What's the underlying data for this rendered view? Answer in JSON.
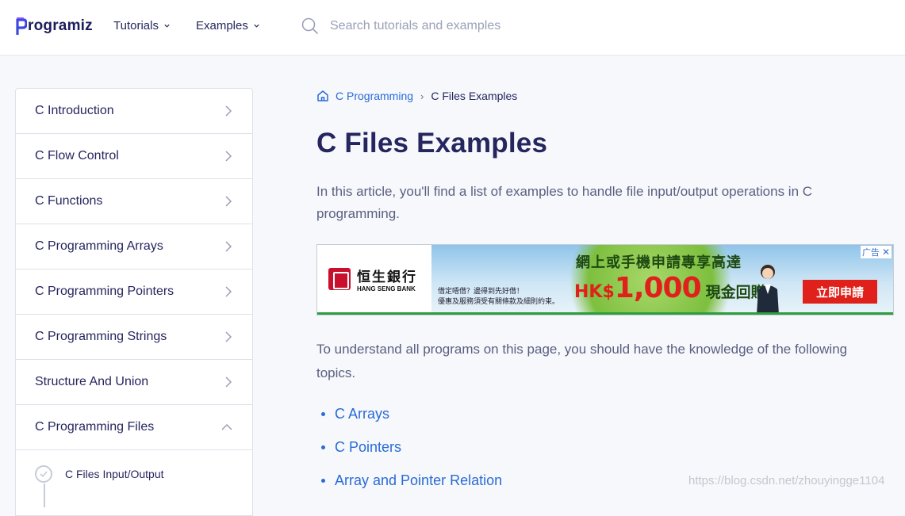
{
  "header": {
    "logo_text": "rogramiz",
    "nav": [
      {
        "label": "Tutorials"
      },
      {
        "label": "Examples"
      }
    ],
    "search_placeholder": "Search tutorials and examples"
  },
  "sidebar": {
    "items": [
      {
        "label": "C Introduction"
      },
      {
        "label": "C Flow Control"
      },
      {
        "label": "C Functions"
      },
      {
        "label": "C Programming Arrays"
      },
      {
        "label": "C Programming Pointers"
      },
      {
        "label": "C Programming Strings"
      },
      {
        "label": "Structure And Union"
      },
      {
        "label": "C Programming Files"
      }
    ],
    "sub_items": [
      {
        "label": "C Files Input/Output"
      }
    ]
  },
  "breadcrumb": {
    "parent": "C Programming",
    "current": "C Files Examples"
  },
  "main": {
    "title": "C Files Examples",
    "intro": "In this article, you'll find a list of examples to handle file input/output operations in C programming.",
    "understand": "To understand all programs on this page, you should have the knowledge of the following topics.",
    "topics": [
      "C Arrays",
      "C Pointers",
      "Array and Pointer Relation"
    ]
  },
  "ad": {
    "bank_cn": "恒生銀行",
    "bank_en": "HANG SENG BANK",
    "small_line1": "借定唔借？邊得到先好借！",
    "small_line2": "優惠及服務須受有關條款及細則約束。",
    "headline": "網上或手機申請專享高達",
    "amount_prefix": "HK$",
    "amount": "1,000",
    "amount_tail": "現金回贈",
    "cta": "立即申請",
    "badge": "广告",
    "colors": {
      "brand_red": "#e0201a",
      "green": "#2e9e3d"
    }
  },
  "watermark": "https://blog.csdn.net/zhouyingge1104",
  "colors": {
    "link": "#2a6bd6",
    "heading": "#25265e",
    "body_text": "#5b5f82"
  }
}
